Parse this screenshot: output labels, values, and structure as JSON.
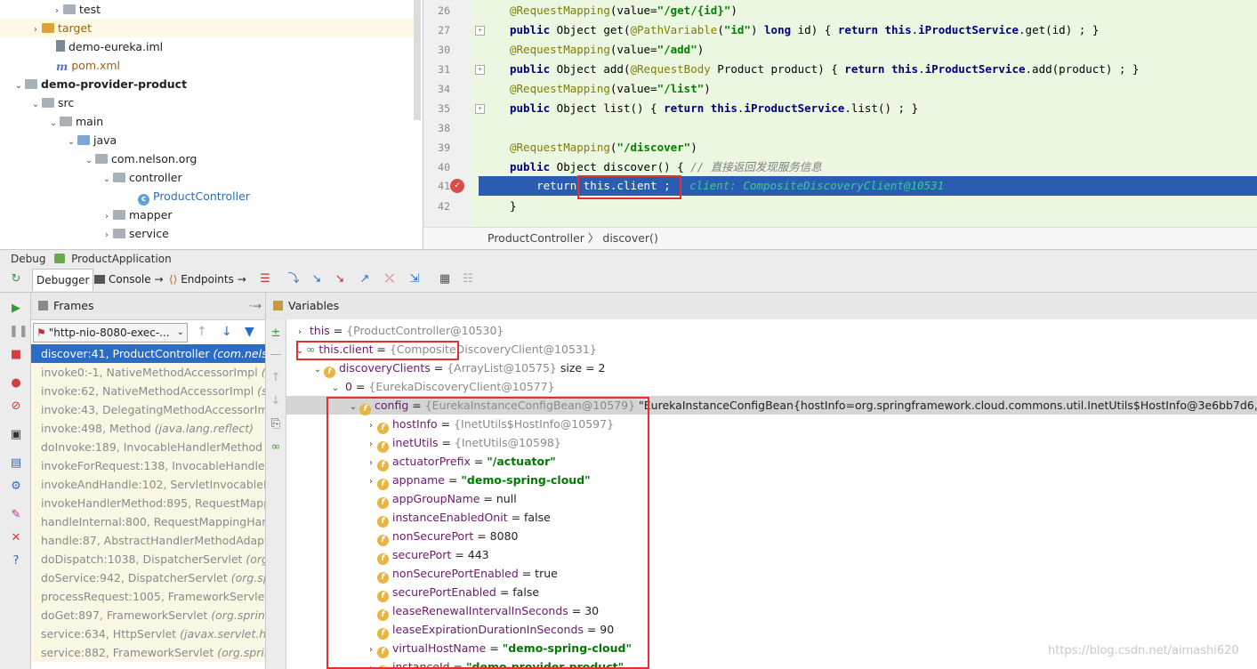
{
  "project_tree": [
    {
      "label": "test",
      "indent": 71,
      "arrow": "›",
      "icon": "folder"
    },
    {
      "label": "target",
      "indent": 47,
      "arrow": "›",
      "icon": "folder-orange",
      "style": "orange"
    },
    {
      "label": "demo-eureka.iml",
      "indent": 63,
      "arrow": "",
      "icon": "file"
    },
    {
      "label": "pom.xml",
      "indent": 63,
      "arrow": "",
      "icon": "maven",
      "style": "orange"
    },
    {
      "label": "demo-provider-product",
      "indent": 28,
      "arrow": "⌄",
      "icon": "folder",
      "style": "bold"
    },
    {
      "label": "src",
      "indent": 47,
      "arrow": "⌄",
      "icon": "folder"
    },
    {
      "label": "main",
      "indent": 67,
      "arrow": "⌄",
      "icon": "folder"
    },
    {
      "label": "java",
      "indent": 87,
      "arrow": "⌄",
      "icon": "folder-blue"
    },
    {
      "label": "com.nelson.org",
      "indent": 107,
      "arrow": "⌄",
      "icon": "folder"
    },
    {
      "label": "controller",
      "indent": 127,
      "arrow": "⌄",
      "icon": "folder"
    },
    {
      "label": "ProductController",
      "indent": 155,
      "arrow": "",
      "icon": "class",
      "style": "blue"
    },
    {
      "label": "mapper",
      "indent": 127,
      "arrow": "›",
      "icon": "folder"
    },
    {
      "label": "service",
      "indent": 127,
      "arrow": "›",
      "icon": "folder"
    }
  ],
  "editor": {
    "lines": [
      {
        "no": "26",
        "html": "<span class='ann'>@RequestMapping</span>(value=<span class='str'>\"/get/{id}\"</span>)"
      },
      {
        "no": "27",
        "html": "<span class='kw'>public</span> Object get(<span class='ann'>@PathVariable</span>(<span class='str'>\"id\"</span>) <span class='kw'>long</span> id) { <span class='kw'>return this</span>.<span class='kw'>iProductService</span>.get(id) ; }"
      },
      {
        "no": "30",
        "html": "<span class='ann'>@RequestMapping</span>(value=<span class='str'>\"/add\"</span>)"
      },
      {
        "no": "31",
        "html": "<span class='kw'>public</span> Object add(<span class='ann'>@RequestBody</span> Product product) { <span class='kw'>return this</span>.<span class='kw'>iProductService</span>.add(product) ; }"
      },
      {
        "no": "34",
        "html": "<span class='ann'>@RequestMapping</span>(value=<span class='str'>\"/list\"</span>)"
      },
      {
        "no": "35",
        "html": "<span class='kw'>public</span> Object list() { <span class='kw'>return this</span>.<span class='kw'>iProductService</span>.list() ; }"
      },
      {
        "no": "38",
        "html": ""
      },
      {
        "no": "39",
        "html": "<span class='ann'>@RequestMapping</span>(<span class='str'>\"/discover\"</span>)"
      },
      {
        "no": "40",
        "html": "<span class='kw'>public</span> Object discover() { <span class='cmt'>// 直接返回发现服务信息</span>"
      },
      {
        "no": "41",
        "html": ""
      },
      {
        "no": "42",
        "html": "}"
      }
    ],
    "current_line": {
      "no": "41",
      "code": "    return this.client ;",
      "inline_value": "client: CompositeDiscoveryClient@10531"
    },
    "breadcrumb": "ProductController  〉 discover()"
  },
  "debug": {
    "title": "Debug",
    "config": "ProductApplication",
    "tabs": [
      "Debugger",
      "Console",
      "Endpoints"
    ],
    "frames_label": "Frames",
    "variables_label": "Variables",
    "thread": "\"http-nio-8080-exec-...",
    "frames": [
      {
        "text": "discover:41, ProductController ",
        "pkg": "(com.nelson.",
        "current": true
      },
      {
        "text": "invoke0:-1, NativeMethodAccessorImpl ",
        "pkg": "(sun"
      },
      {
        "text": "invoke:62, NativeMethodAccessorImpl ",
        "pkg": "(sun"
      },
      {
        "text": "invoke:43, DelegatingMethodAccessorImpl",
        "pkg": ""
      },
      {
        "text": "invoke:498, Method ",
        "pkg": "(java.lang.reflect)"
      },
      {
        "text": "doInvoke:189, InvocableHandlerMethod ",
        "pkg": "(o"
      },
      {
        "text": "invokeForRequest:138, InvocableHandlerMe",
        "pkg": ""
      },
      {
        "text": "invokeAndHandle:102, ServletInvocableHan",
        "pkg": ""
      },
      {
        "text": "invokeHandlerMethod:895, RequestMappin",
        "pkg": ""
      },
      {
        "text": "handleInternal:800, RequestMappingHandle",
        "pkg": ""
      },
      {
        "text": "handle:87, AbstractHandlerMethodAdapter",
        "pkg": ""
      },
      {
        "text": "doDispatch:1038, DispatcherServlet ",
        "pkg": "(org.sp"
      },
      {
        "text": "doService:942, DispatcherServlet ",
        "pkg": "(org.spr"
      },
      {
        "text": "processRequest:1005, FrameworkServlet ",
        "pkg": "(o"
      },
      {
        "text": "doGet:897, FrameworkServlet ",
        "pkg": "(org.springfr"
      },
      {
        "text": "service:634, HttpServlet ",
        "pkg": "(javax.servlet.http)"
      },
      {
        "text": "service:882, FrameworkServlet ",
        "pkg": "(org.springf"
      }
    ],
    "variables": [
      {
        "indent": 8,
        "arrow": "›",
        "icon": "",
        "name": "this",
        "val": " = ",
        "type": "{ProductController@10530}",
        "extra": ""
      },
      {
        "indent": 8,
        "arrow": "⌄",
        "icon": "oo",
        "name": "this.client",
        "val": " = ",
        "type": "{CompositeDiscoveryClient@10531}",
        "extra": ""
      },
      {
        "indent": 28,
        "arrow": "⌄",
        "icon": "f",
        "name": "discoveryClients",
        "val": " = ",
        "type": "{ArrayList@10575}",
        "extra": "  size = 2"
      },
      {
        "indent": 48,
        "arrow": "⌄",
        "icon": "",
        "name": "0",
        "val": " = ",
        "type": "{EurekaDiscoveryClient@10577}",
        "extra": ""
      },
      {
        "indent": 68,
        "arrow": "⌄",
        "icon": "f",
        "name": "config",
        "val": " = ",
        "type": "{EurekaInstanceConfigBean@10579}",
        "extra": " \"EurekaInstanceConfigBean{hostInfo=org.springframework.cloud.commons.util.InetUtils$HostInfo@3e6bb7d6, inetUtils=org.spri",
        "sel": true
      },
      {
        "indent": 88,
        "arrow": "›",
        "icon": "f",
        "name": "hostInfo",
        "val": " = ",
        "type": "{InetUtils$HostInfo@10597}",
        "extra": ""
      },
      {
        "indent": 88,
        "arrow": "›",
        "icon": "f",
        "name": "inetUtils",
        "val": " = ",
        "type": "{InetUtils@10598}",
        "extra": ""
      },
      {
        "indent": 88,
        "arrow": "›",
        "icon": "f",
        "name": "actuatorPrefix",
        "val": " = ",
        "str": "\"/actuator\""
      },
      {
        "indent": 88,
        "arrow": "›",
        "icon": "f",
        "name": "appname",
        "val": " = ",
        "str": "\"demo-spring-cloud\""
      },
      {
        "indent": 88,
        "arrow": "",
        "icon": "f",
        "name": "appGroupName",
        "val": " = null"
      },
      {
        "indent": 88,
        "arrow": "",
        "icon": "f",
        "name": "instanceEnabledOnit",
        "val": " = false"
      },
      {
        "indent": 88,
        "arrow": "",
        "icon": "f",
        "name": "nonSecurePort",
        "val": " = 8080"
      },
      {
        "indent": 88,
        "arrow": "",
        "icon": "f",
        "name": "securePort",
        "val": " = 443"
      },
      {
        "indent": 88,
        "arrow": "",
        "icon": "f",
        "name": "nonSecurePortEnabled",
        "val": " = true"
      },
      {
        "indent": 88,
        "arrow": "",
        "icon": "f",
        "name": "securePortEnabled",
        "val": " = false"
      },
      {
        "indent": 88,
        "arrow": "",
        "icon": "f",
        "name": "leaseRenewalIntervalInSeconds",
        "val": " = 30"
      },
      {
        "indent": 88,
        "arrow": "",
        "icon": "f",
        "name": "leaseExpirationDurationInSeconds",
        "val": " = 90"
      },
      {
        "indent": 88,
        "arrow": "›",
        "icon": "f",
        "name": "virtualHostName",
        "val": " = ",
        "str": "\"demo-spring-cloud\""
      },
      {
        "indent": 88,
        "arrow": "›",
        "icon": "f",
        "name": "instanceId",
        "val": " = ",
        "str": "\"demo-provider-product\""
      }
    ]
  },
  "watermark": "https://blog.csdn.net/aimashi620"
}
